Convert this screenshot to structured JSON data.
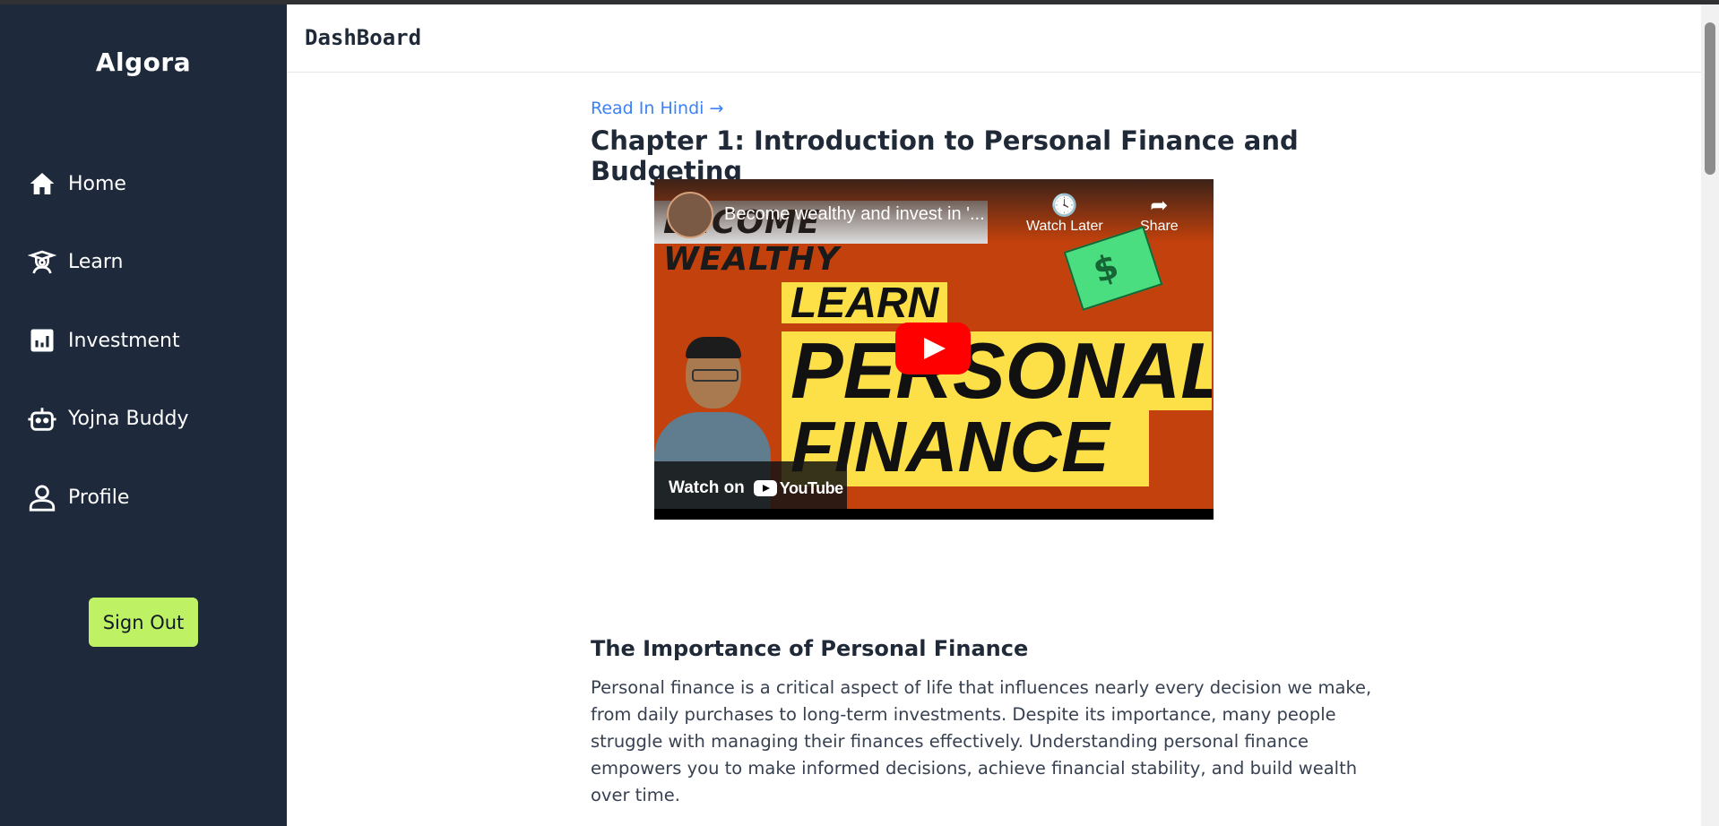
{
  "app": {
    "brand": "Algora"
  },
  "sidebar": {
    "items": [
      {
        "label": "Home",
        "icon": "home-icon"
      },
      {
        "label": "Learn",
        "icon": "graduate-icon"
      },
      {
        "label": "Investment",
        "icon": "chart-icon"
      },
      {
        "label": "Yojna Buddy",
        "icon": "robot-icon"
      },
      {
        "label": "Profile",
        "icon": "user-icon"
      }
    ],
    "signout_label": "Sign Out"
  },
  "header": {
    "title": "DashBoard"
  },
  "main": {
    "read_in_hindi": "Read In Hindi →",
    "chapter_title": "Chapter 1: Introduction to Personal Finance and Budgeting",
    "video": {
      "title": "Become wealthy and invest in '...",
      "thumbnail_strip": "BECOME WEALTHY",
      "watch_later": "Watch Later",
      "share": "Share",
      "banner_line1": "LEARN",
      "banner_line2": "PERSONAL",
      "banner_line3": "FINANCE",
      "watch_on": "Watch on",
      "youtube": "YouTube"
    },
    "section_title": "The Importance of Personal Finance",
    "paragraph": "Personal finance is a critical aspect of life that influences nearly every decision we make, from daily purchases to long-term investments. Despite its importance, many people struggle with managing their finances effectively. Understanding personal finance empowers you to make informed decisions, achieve financial stability, and build wealth over time."
  },
  "colors": {
    "sidebar_bg": "#1e293b",
    "signout_bg": "#bef264",
    "link": "#3b82f6"
  }
}
